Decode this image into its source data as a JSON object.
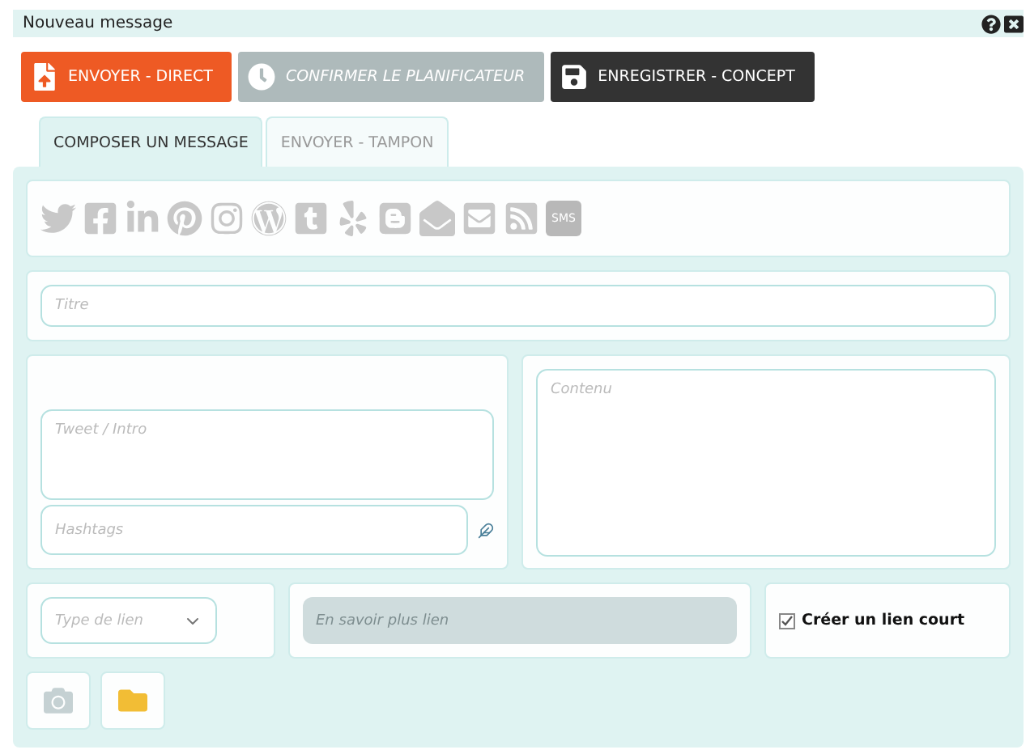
{
  "window": {
    "title": "Nouveau message"
  },
  "actions": [
    {
      "kind": "send",
      "label": "ENVOYER - DIRECT",
      "disabled": false
    },
    {
      "kind": "schedule",
      "label": "CONFIRMER LE PLANIFICATEUR",
      "disabled": true
    },
    {
      "kind": "save",
      "label": "ENREGISTRER - CONCEPT",
      "disabled": false
    }
  ],
  "tabs": [
    {
      "label": "COMPOSER UN MESSAGE",
      "selected": true
    },
    {
      "label": "ENVOYER - TAMPON",
      "selected": false
    }
  ],
  "sms_label": "SMS",
  "title_field": {
    "placeholder": "Titre"
  },
  "intro_field": {
    "placeholder": "Tweet / Intro"
  },
  "hashtags_field": {
    "placeholder": "Hashtags"
  },
  "content_field": {
    "placeholder": "Contenu"
  },
  "link_type": {
    "placeholder": "Type de lien"
  },
  "more_link": {
    "placeholder": "En savoir plus lien",
    "disabled": true
  },
  "short_link": {
    "label": "Créer un lien court",
    "checked": true
  }
}
